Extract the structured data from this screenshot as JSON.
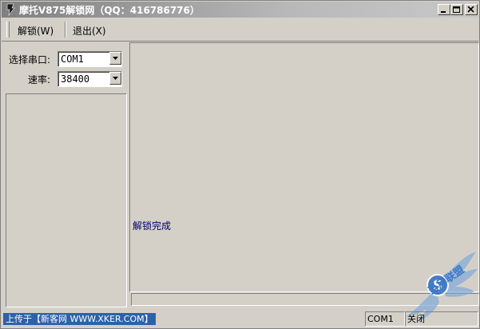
{
  "window": {
    "title": "摩托V875解锁网（QQ：416786776）"
  },
  "menu": {
    "unlock": "解锁(W)",
    "exit": "退出(X)"
  },
  "settings": {
    "port_label": "选择串口:",
    "port_value": "COM1",
    "baud_label": "速率:",
    "baud_value": "38400"
  },
  "main": {
    "message": "解锁完成"
  },
  "statusbar": {
    "upload_note": "上传于【新客网 WWW.XKER.COM】",
    "port": "COM1",
    "state": "关闭"
  },
  "watermark": {
    "text": "当月联盟"
  },
  "colors": {
    "face": "#d4d0c8",
    "message": "#00006a",
    "upload_bg": "#2b62a8"
  },
  "icons": [
    "app-icon",
    "minimize-icon",
    "maximize-icon",
    "close-icon",
    "dropdown-arrow-icon",
    "winged-s-logo"
  ]
}
